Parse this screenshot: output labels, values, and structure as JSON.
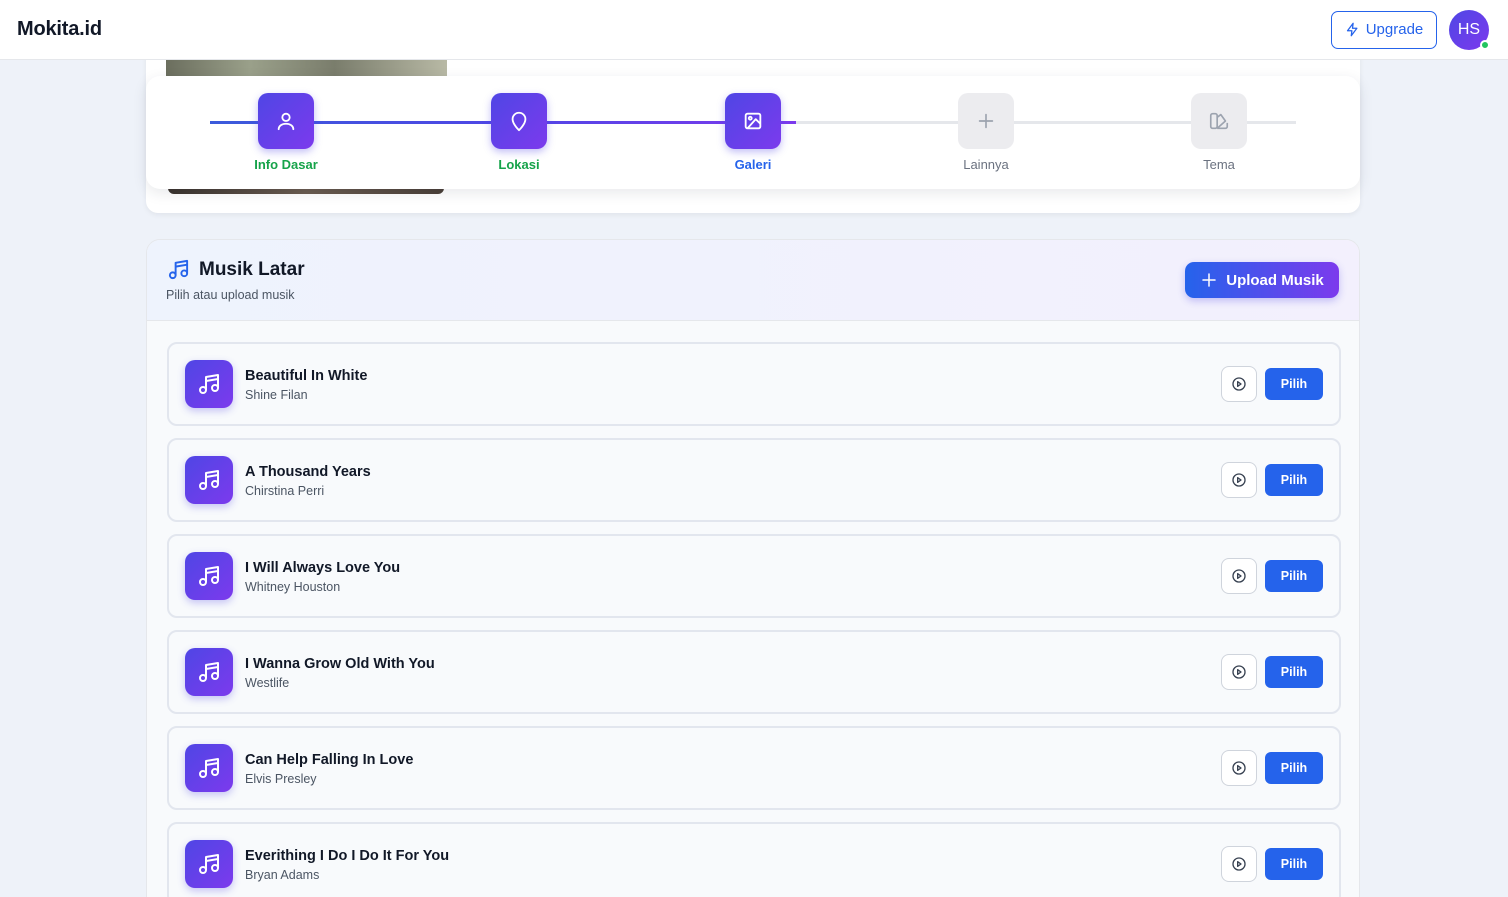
{
  "header": {
    "brand": "Mokita.id",
    "upgrade_label": "Upgrade",
    "avatar_initials": "HS",
    "online_color": "#22c55e"
  },
  "stepper": {
    "progress_fraction": 0.54,
    "steps": [
      {
        "label": "Info Dasar",
        "icon": "user-icon",
        "state": "done"
      },
      {
        "label": "Lokasi",
        "icon": "map-pin-icon",
        "state": "done"
      },
      {
        "label": "Galeri",
        "icon": "image-icon",
        "state": "current"
      },
      {
        "label": "Lainnya",
        "icon": "plus-icon",
        "state": "pending"
      },
      {
        "label": "Tema",
        "icon": "palette-icon",
        "state": "pending"
      }
    ]
  },
  "music": {
    "title": "Musik Latar",
    "subtitle": "Pilih atau upload musik",
    "upload_label": "Upload Musik",
    "select_label": "Pilih",
    "songs": [
      {
        "title": "Beautiful In White",
        "artist": "Shine Filan"
      },
      {
        "title": "A Thousand Years",
        "artist": "Chirstina Perri"
      },
      {
        "title": "I Will Always Love You",
        "artist": "Whitney Houston"
      },
      {
        "title": "I Wanna Grow Old With You",
        "artist": "Westlife"
      },
      {
        "title": "Can Help Falling In Love",
        "artist": "Elvis Presley"
      },
      {
        "title": "Everithing I Do I Do It For You",
        "artist": "Bryan Adams"
      }
    ]
  },
  "colors": {
    "accent": "#2563eb",
    "gradient_start": "#4f46e5",
    "gradient_end": "#7c3aed",
    "done": "#16a34a"
  }
}
